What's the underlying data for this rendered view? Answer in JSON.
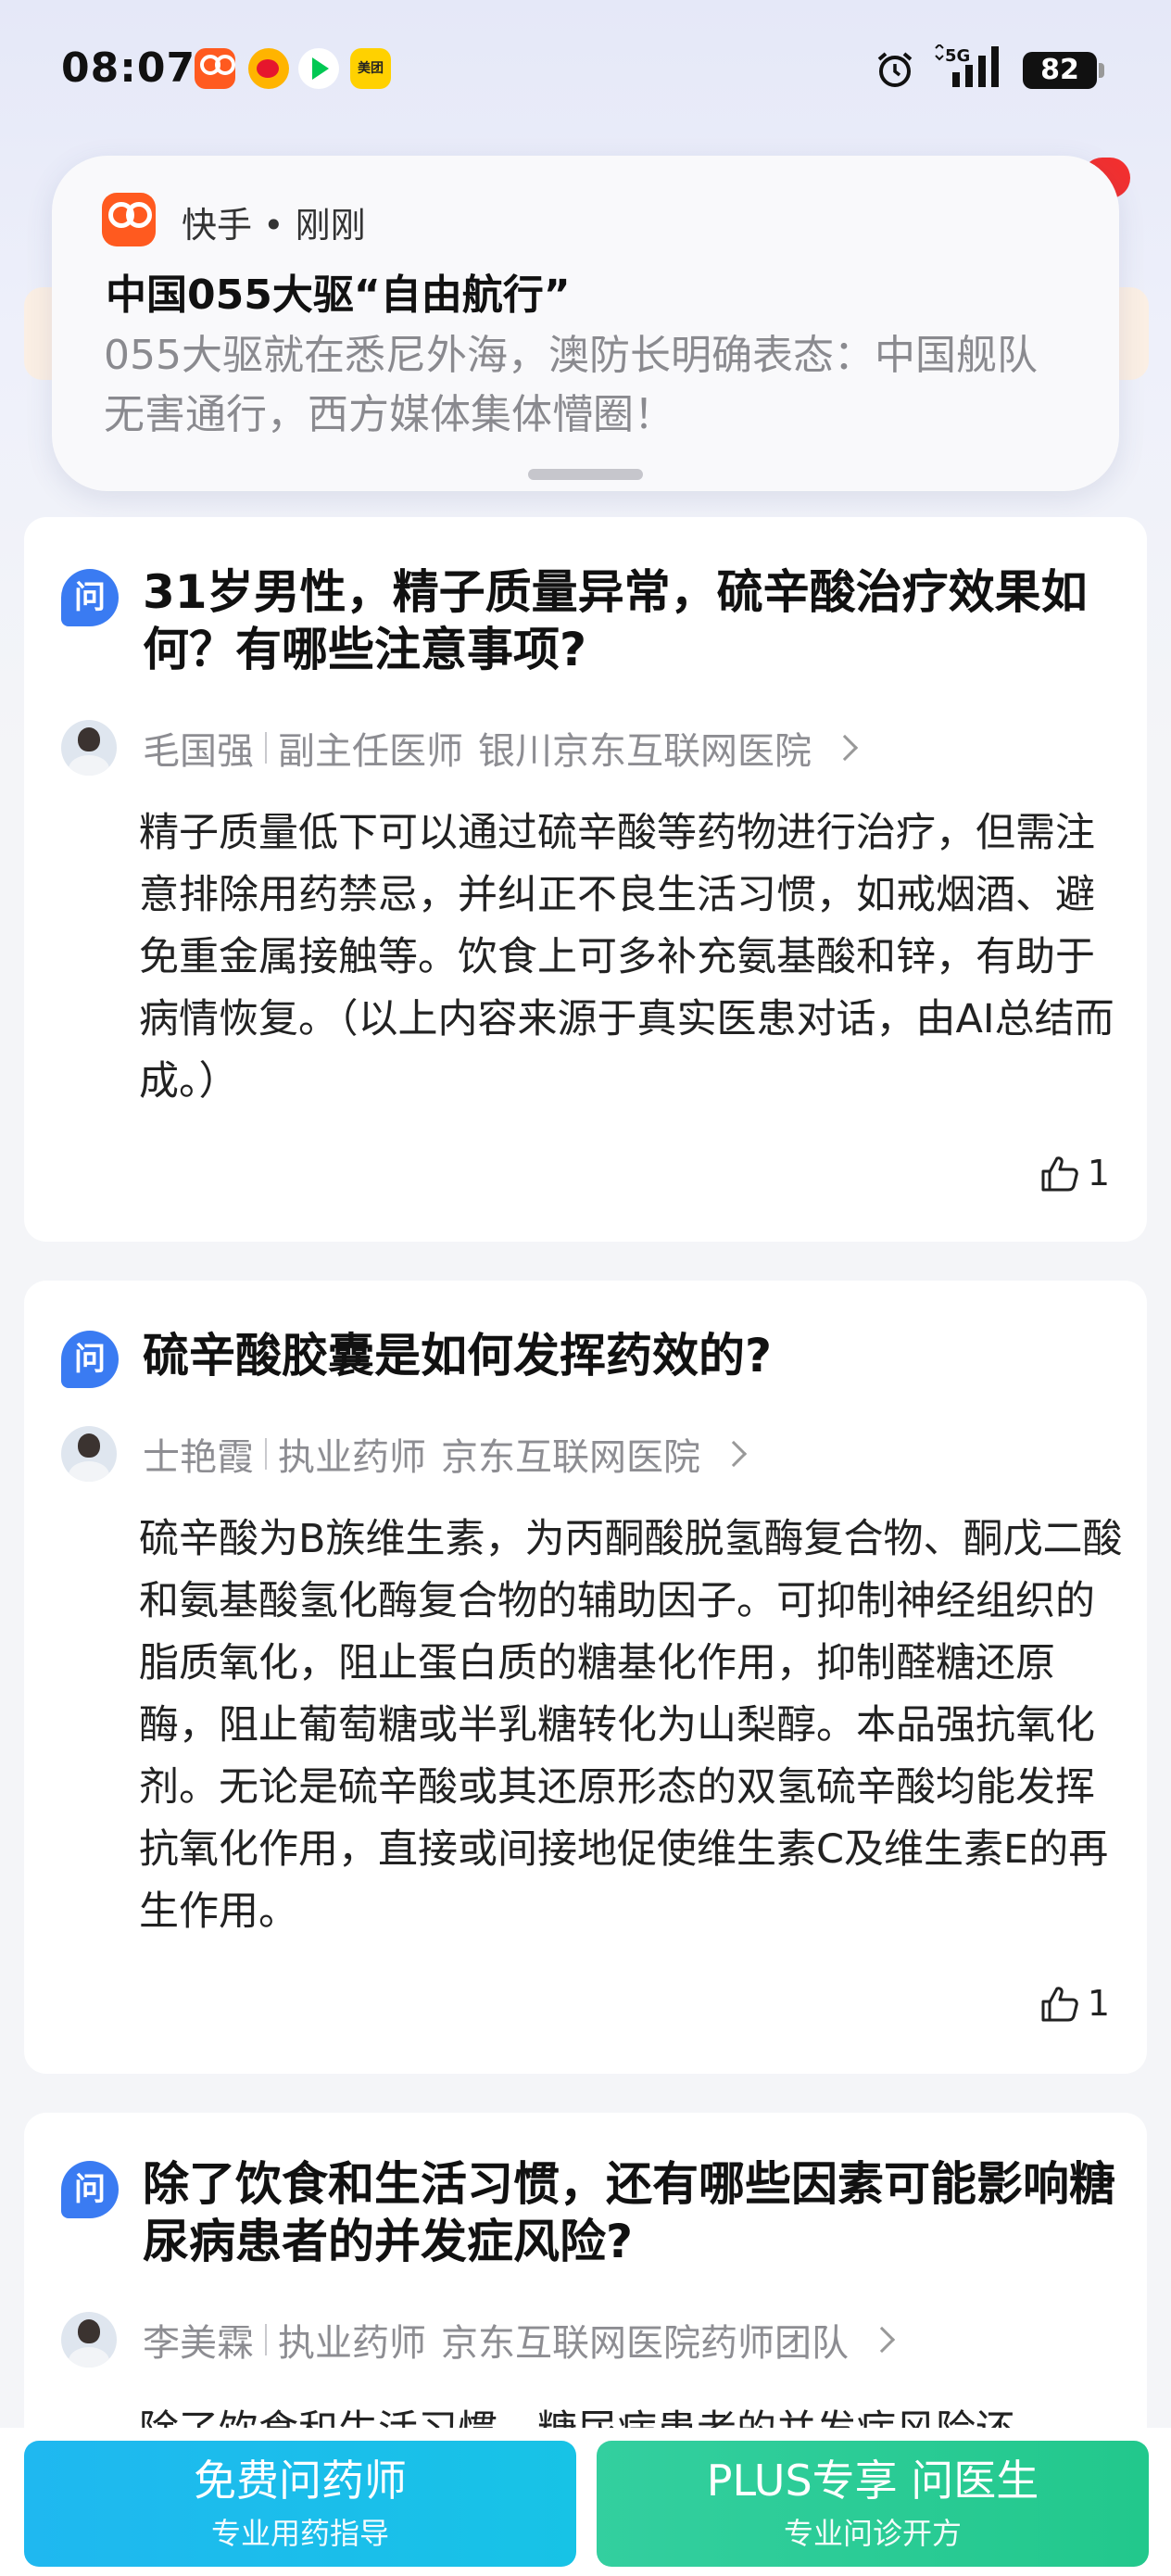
{
  "status_bar": {
    "time": "08:07",
    "app_icons": [
      "kuaishou-icon",
      "weibo-icon",
      "iqiyi-icon",
      "meituan-icon"
    ],
    "meituan_label": "美团",
    "network": "5G",
    "battery": "82"
  },
  "notification": {
    "app": "快手 • 刚刚",
    "title": "中国055大驱“自由航行”",
    "body": "055大驱就在悉尼外海，澳防长明确表态：中国舰队无害通行，西方媒体集体懵圈！"
  },
  "cards": [
    {
      "icon_label": "问",
      "question": "31岁男性，精子质量异常，硫辛酸治疗效果如何？有哪些注意事项?",
      "doctor_name": "毛国强",
      "doctor_title": "副主任医师",
      "hospital": "银川京东互联网医院",
      "answer": "精子质量低下可以通过硫辛酸等药物进行治疗，但需注意排除用药禁忌，并纠正不良生活习惯，如戒烟酒、避免重金属接触等。饮食上可多补充氨基酸和锌，有助于病情恢复。（以上内容来源于真实医患对话，由AI总结而成。）",
      "likes": "1"
    },
    {
      "icon_label": "问",
      "question": "硫辛酸胶囊是如何发挥药效的?",
      "doctor_name": "士艳霞",
      "doctor_title": "执业药师",
      "hospital": "京东互联网医院",
      "answer": "硫辛酸为B族维生素，为丙酮酸脱氢酶复合物、酮戊二酸和氨基酸氢化酶复合物的辅助因子。可抑制神经组织的脂质氧化，阻止蛋白质的糖基化作用，抑制醛糖还原酶，阻止葡萄糖或半乳糖转化为山梨醇。本品强抗氧化剂。无论是硫辛酸或其还原形态的双氢硫辛酸均能发挥抗氧化作用，直接或间接地促使维生素C及维生素E的再生作用。",
      "likes": "1"
    },
    {
      "icon_label": "问",
      "question": "除了饮食和生活习惯，还有哪些因素可能影响糖尿病患者的并发症风险?",
      "doctor_name": "李美霖",
      "doctor_title": "执业药师",
      "hospital": "京东互联网医院药师团队",
      "answer": "除了饮食和生活习惯，糖尿病患者的并发症风险还"
    }
  ],
  "bottom": {
    "pharmacist_main": "免费问药师",
    "pharmacist_sub": "专业用药指导",
    "doctor_main": "PLUS专享 问医生",
    "doctor_sub": "专业问诊开方"
  },
  "colors": {
    "accent_blue": "#3a7bf2",
    "pharmacist_button": "#1fb8f0",
    "doctor_button": "#2ecb96"
  }
}
